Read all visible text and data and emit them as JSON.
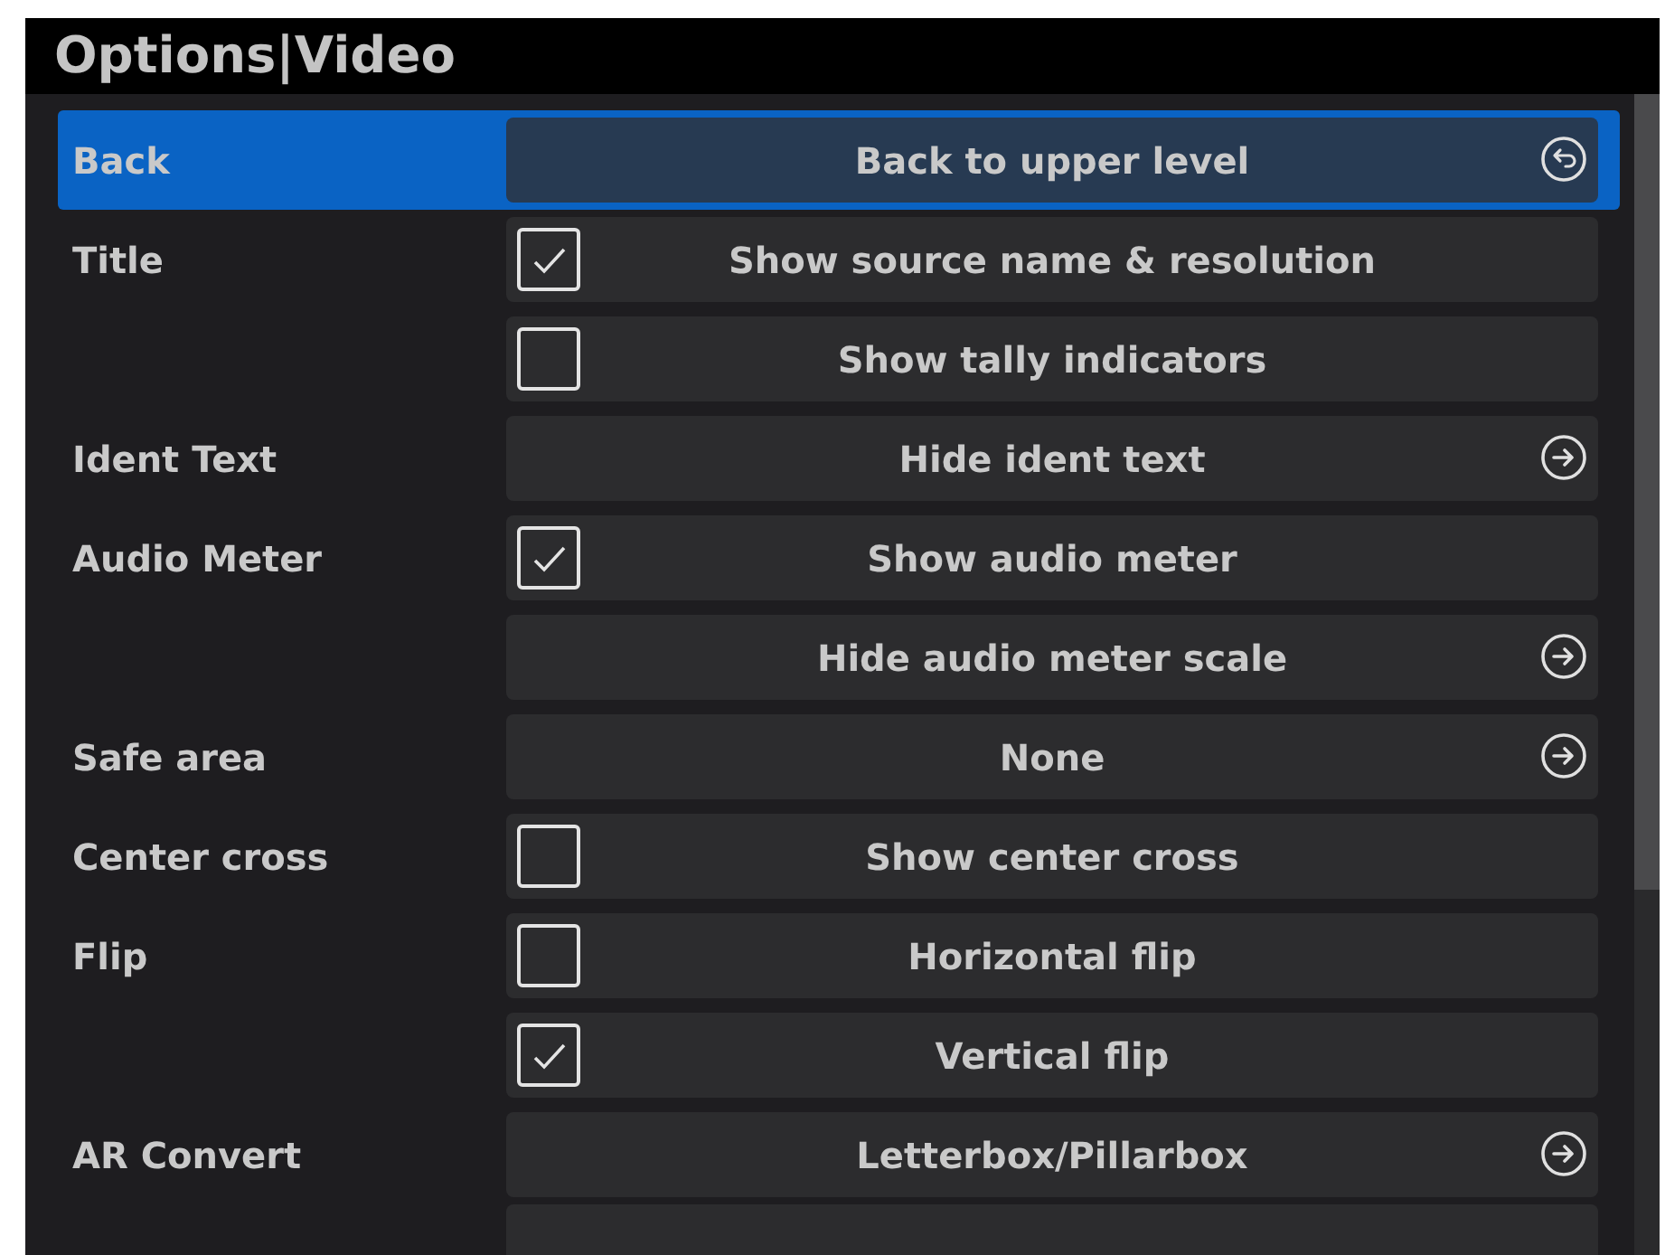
{
  "window": {
    "title": "Options|Video"
  },
  "rows": [
    {
      "label": "Back",
      "kind": "back",
      "value": "Back to upper level",
      "selected": true
    },
    {
      "label": "Title",
      "kind": "check",
      "value": "Show source name & resolution",
      "checked": true,
      "selected": false
    },
    {
      "kind": "check",
      "value": "Show tally indicators",
      "checked": false,
      "selected": false
    },
    {
      "label": "Ident Text",
      "kind": "link",
      "value": "Hide ident text",
      "selected": false
    },
    {
      "label": "Audio Meter",
      "kind": "check",
      "value": "Show audio meter",
      "checked": true,
      "selected": false
    },
    {
      "kind": "link",
      "value": "Hide audio meter scale",
      "selected": false
    },
    {
      "label": "Safe area",
      "kind": "link",
      "value": "None",
      "selected": false
    },
    {
      "label": "Center cross",
      "kind": "check",
      "value": "Show center cross",
      "checked": false,
      "selected": false
    },
    {
      "label": "Flip",
      "kind": "check",
      "value": "Horizontal flip",
      "checked": false,
      "selected": false
    },
    {
      "kind": "check",
      "value": "Vertical flip",
      "checked": true,
      "selected": false
    },
    {
      "label": "AR Convert",
      "kind": "link",
      "value": "Letterbox/Pillarbox",
      "selected": false
    }
  ]
}
